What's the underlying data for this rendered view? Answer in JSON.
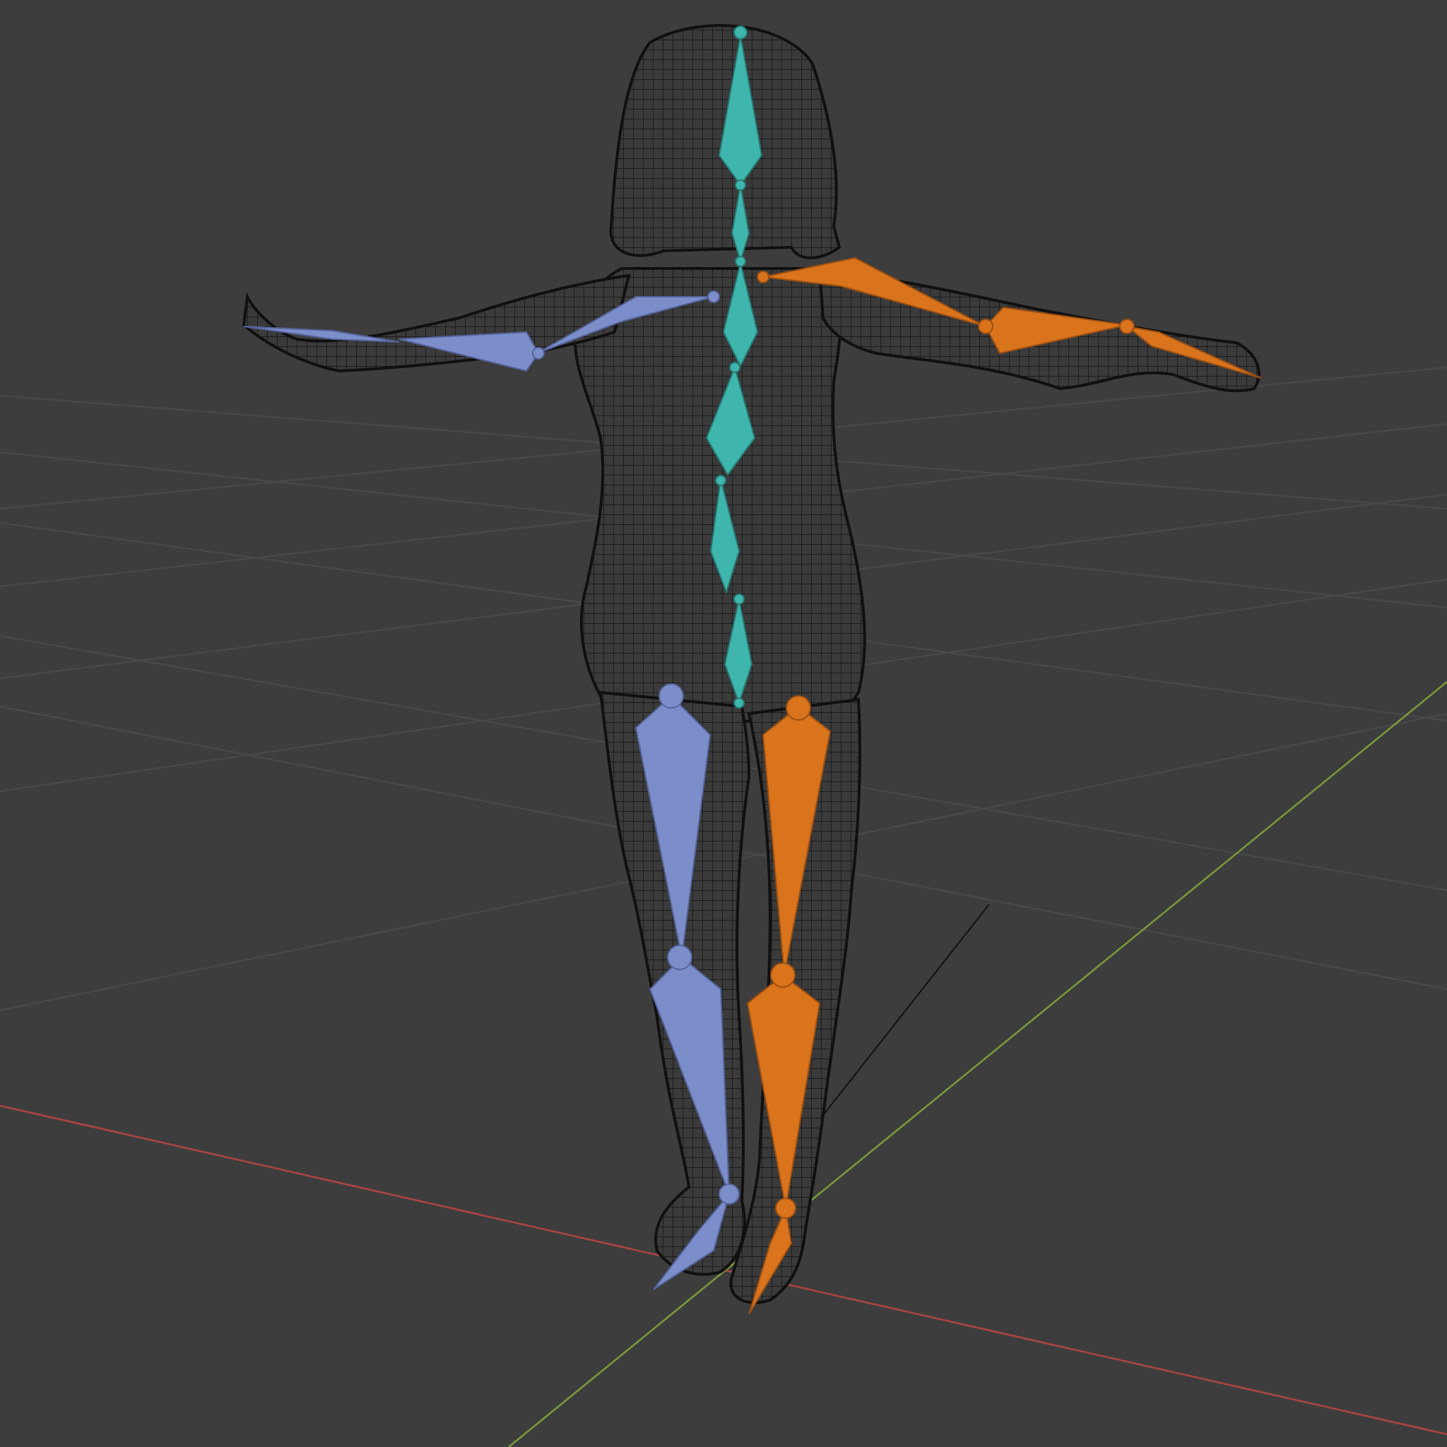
{
  "viewport": {
    "mode": "wireframe",
    "background_color": "#3d3d3d",
    "grid_color": "#4a4a4a",
    "x_axis_color": "#b04444",
    "y_axis_color": "#7c9a3a"
  },
  "armature": {
    "center_color": "#3fb6ad",
    "left_color": "#7c8ec9",
    "right_color": "#d9731c",
    "bones": {
      "center": [
        "head",
        "neck",
        "spine_upper",
        "spine_mid",
        "spine_lower",
        "pelvis"
      ],
      "left": [
        "upper_arm_l",
        "forearm_l",
        "hand_l",
        "thigh_l",
        "shin_l",
        "foot_l"
      ],
      "right": [
        "upper_arm_r",
        "forearm_r",
        "hand_r",
        "thigh_r",
        "shin_r",
        "foot_r"
      ]
    }
  },
  "mesh": {
    "type": "humanoid",
    "display": "wire",
    "wire_color": "#0d0d0d"
  }
}
